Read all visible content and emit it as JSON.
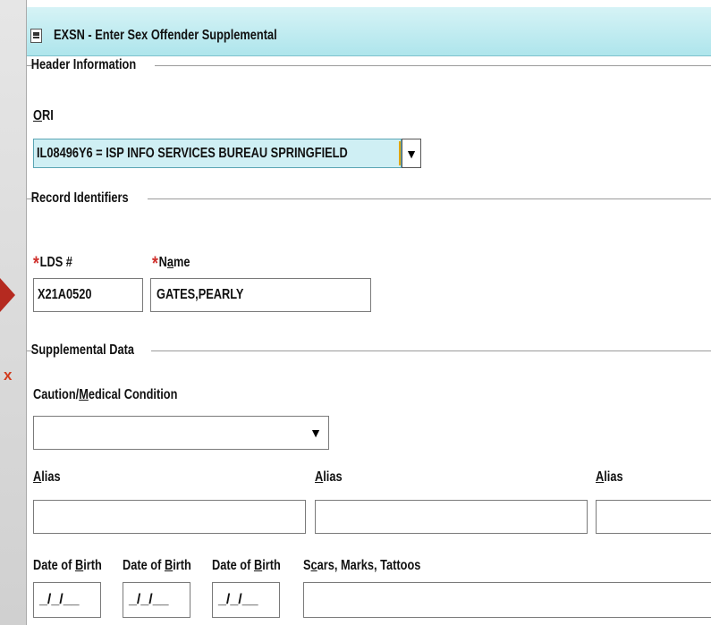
{
  "window": {
    "title": "EXSN - Enter Sex Offender Supplemental"
  },
  "annotations": {
    "x_mark": "x",
    "accent_color": "#b52a20"
  },
  "header_info": {
    "legend": "Header Information",
    "ori_label_first": "O",
    "ori_label_rest": "RI",
    "ori_value": "IL08496Y6 = ISP INFO SERVICES BUREAU SPRINGFIELD"
  },
  "record_identifiers": {
    "legend": "Record Identifiers",
    "required_mark": "*",
    "lds_label": "LDS #",
    "lds_value": "X21A0520",
    "name_label_pre": "N",
    "name_label_u": "a",
    "name_label_post": "me",
    "name_value": "GATES,PEARLY"
  },
  "supplemental": {
    "legend": "Supplemental Data",
    "caution_label_pre": "Caution/",
    "caution_label_u": "M",
    "caution_label_post": "edical Condition",
    "caution_value": "",
    "alias_label_u": "A",
    "alias_label_rest": "lias",
    "dob_label_pre": "Date of ",
    "dob_label_u": "B",
    "dob_label_post": "irth",
    "dob_placeholder": "_/_/__",
    "smt_label_pre": "S",
    "smt_label_u": "c",
    "smt_label_post": "ars, Marks, Tattoos"
  },
  "icons": {
    "dropdown": "▼"
  }
}
